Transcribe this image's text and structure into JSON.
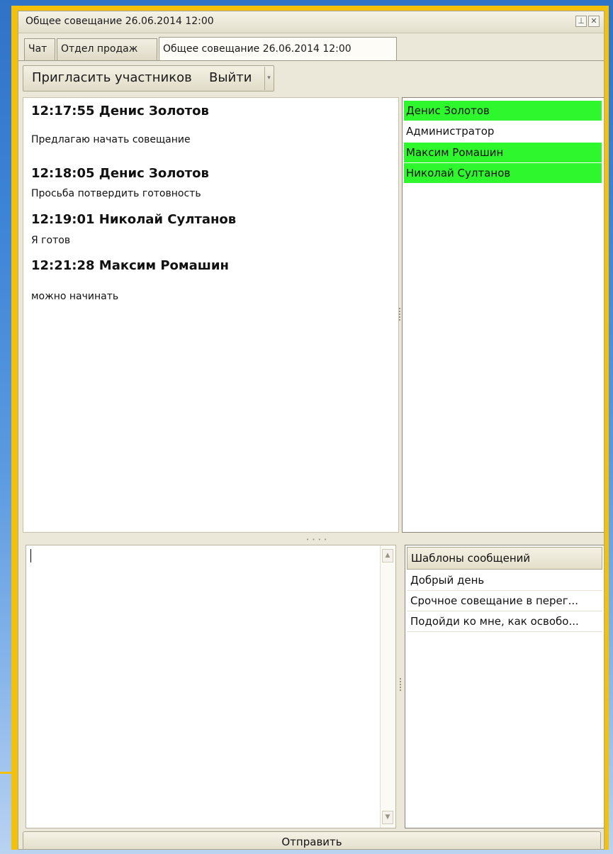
{
  "window": {
    "title": "Общее совещание 26.06.2014 12:00",
    "pin_icon": "pin-icon",
    "close_icon": "close-icon"
  },
  "tabs": [
    {
      "label": "Чат"
    },
    {
      "label": "Отдел продаж"
    },
    {
      "label": "Общее совещание 26.06.2014 12:00",
      "active": true
    }
  ],
  "toolbar": {
    "invite_label": "Пригласить участников",
    "exit_label": "Выйти",
    "dropdown_icon": "chevron-down-icon"
  },
  "messages": [
    {
      "time": "12:17:55",
      "author": "Денис Золотов",
      "header": "12:17:55  Денис Золотов",
      "text": "Предлагаю начать совещание"
    },
    {
      "time": "12:18:05",
      "author": "Денис Золотов",
      "header": "12:18:05  Денис Золотов",
      "text": "Просьба потвердить готовность"
    },
    {
      "time": "12:19:01",
      "author": "Николай Султанов",
      "header": "12:19:01  Николай Султанов",
      "text": "Я готов"
    },
    {
      "time": "12:21:28",
      "author": "Максим Ромашин",
      "header": "12:21:28  Максим Ромашин",
      "text": "можно начинать"
    }
  ],
  "participants": [
    {
      "name": "Денис Золотов",
      "online": true
    },
    {
      "name": "Администратор",
      "online": false
    },
    {
      "name": "Максим Ромашин",
      "online": true
    },
    {
      "name": "Николай Султанов",
      "online": true
    }
  ],
  "colors": {
    "online_highlight": "#2ef72e",
    "frame_accent": "#f3c10a"
  },
  "compose": {
    "value": ""
  },
  "templates": {
    "header": "Шаблоны сообщений",
    "items": [
      "Добрый день",
      "Срочное совещание в перег...",
      "Подойди ко мне, как освобо..."
    ]
  },
  "send_label": "Отправить"
}
